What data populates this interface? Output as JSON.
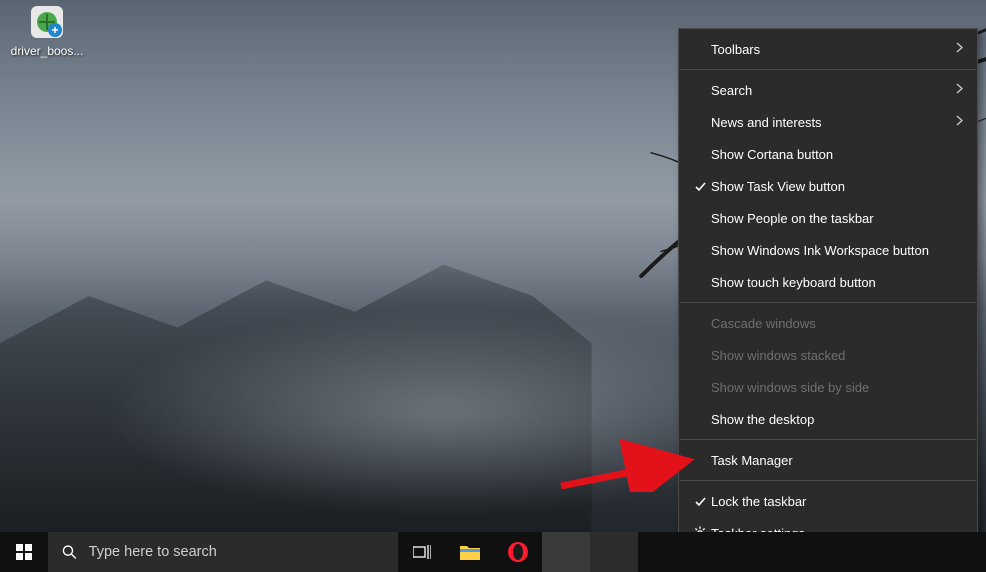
{
  "desktop": {
    "icons": [
      {
        "label": "driver_boos..."
      }
    ]
  },
  "taskbar": {
    "search_placeholder": "Type here to search"
  },
  "context_menu": {
    "items": [
      {
        "label": "Toolbars",
        "has_submenu": true,
        "checked": false,
        "enabled": true,
        "icon": null
      },
      {
        "sep": true
      },
      {
        "label": "Search",
        "has_submenu": true,
        "checked": false,
        "enabled": true,
        "icon": null
      },
      {
        "label": "News and interests",
        "has_submenu": true,
        "checked": false,
        "enabled": true,
        "icon": null
      },
      {
        "label": "Show Cortana button",
        "has_submenu": false,
        "checked": false,
        "enabled": true,
        "icon": null
      },
      {
        "label": "Show Task View button",
        "has_submenu": false,
        "checked": true,
        "enabled": true,
        "icon": null
      },
      {
        "label": "Show People on the taskbar",
        "has_submenu": false,
        "checked": false,
        "enabled": true,
        "icon": null
      },
      {
        "label": "Show Windows Ink Workspace button",
        "has_submenu": false,
        "checked": false,
        "enabled": true,
        "icon": null
      },
      {
        "label": "Show touch keyboard button",
        "has_submenu": false,
        "checked": false,
        "enabled": true,
        "icon": null
      },
      {
        "sep": true
      },
      {
        "label": "Cascade windows",
        "has_submenu": false,
        "checked": false,
        "enabled": false,
        "icon": null
      },
      {
        "label": "Show windows stacked",
        "has_submenu": false,
        "checked": false,
        "enabled": false,
        "icon": null
      },
      {
        "label": "Show windows side by side",
        "has_submenu": false,
        "checked": false,
        "enabled": false,
        "icon": null
      },
      {
        "label": "Show the desktop",
        "has_submenu": false,
        "checked": false,
        "enabled": true,
        "icon": null
      },
      {
        "sep": true
      },
      {
        "label": "Task Manager",
        "has_submenu": false,
        "checked": false,
        "enabled": true,
        "icon": null
      },
      {
        "sep": true
      },
      {
        "label": "Lock the taskbar",
        "has_submenu": false,
        "checked": true,
        "enabled": true,
        "icon": null
      },
      {
        "label": "Taskbar settings",
        "has_submenu": false,
        "checked": false,
        "enabled": true,
        "icon": "gear"
      }
    ]
  }
}
